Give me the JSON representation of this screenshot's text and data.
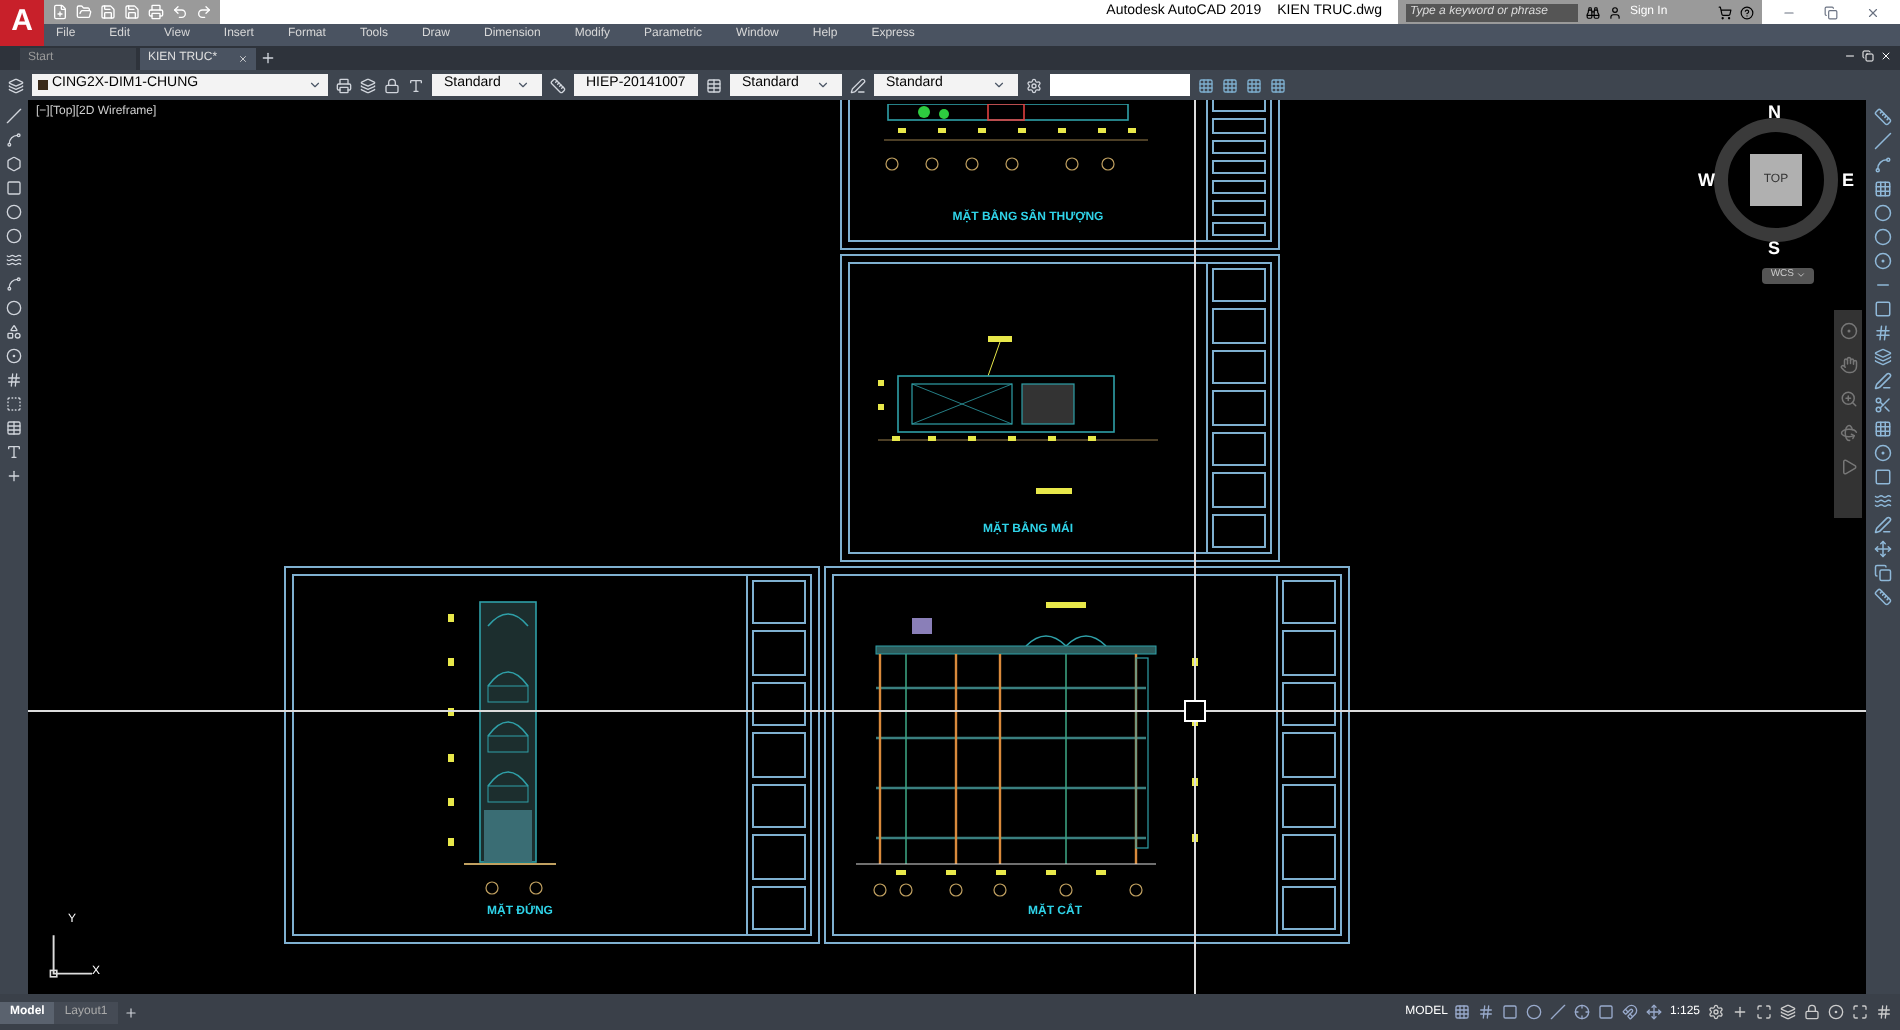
{
  "app": {
    "logo": "A",
    "title": "Autodesk AutoCAD 2019",
    "file": "KIEN TRUC.dwg",
    "search_placeholder": "Type a keyword or phrase",
    "sign_in": "Sign In"
  },
  "menu": [
    "File",
    "Edit",
    "View",
    "Insert",
    "Format",
    "Tools",
    "Draw",
    "Dimension",
    "Modify",
    "Parametric",
    "Window",
    "Help",
    "Express"
  ],
  "doc_tabs": [
    {
      "label": "Start",
      "selected": false
    },
    {
      "label": "KIEN TRUC*",
      "selected": true
    }
  ],
  "toolbar": {
    "layer": "CING2X-DIM1-CHUNG",
    "text_style": "Standard",
    "dim_style": "HIEP-20141007",
    "table_style": "Standard",
    "mleader_style": "Standard"
  },
  "viewport_label": "[−][Top][2D Wireframe]",
  "viewcube": {
    "north": "N",
    "south": "S",
    "east": "E",
    "west": "W",
    "face": "TOP",
    "ucs": "WCS"
  },
  "sheets": [
    {
      "title": "MẶT BẰNG SÂN THƯỢNG",
      "kind": "plan"
    },
    {
      "title": "MẶT BẰNG MÁI",
      "kind": "roof"
    },
    {
      "title": "MẶT ĐỨNG",
      "kind": "elevation"
    },
    {
      "title": "MẶT CẮT",
      "kind": "section"
    }
  ],
  "ucs_axes": {
    "x": "X",
    "y": "Y"
  },
  "layout_tabs": [
    {
      "label": "Model",
      "selected": true
    },
    {
      "label": "Layout1",
      "selected": false
    }
  ],
  "status": {
    "space": "MODEL",
    "scale": "1:125"
  }
}
